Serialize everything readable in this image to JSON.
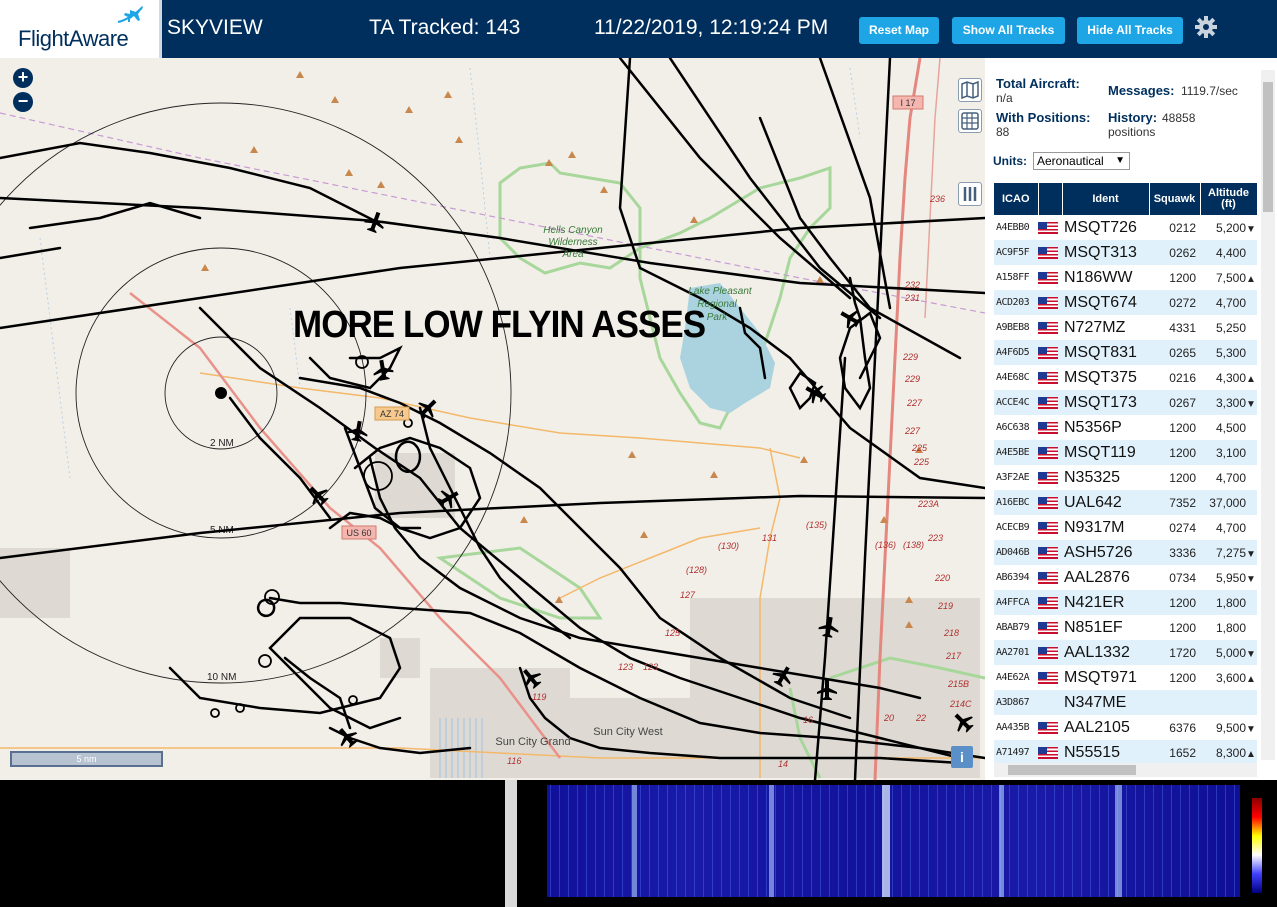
{
  "header": {
    "logo_text": "FlightAware",
    "app_name": "SKYVIEW",
    "tracked_label": "TA Tracked: 143",
    "datetime": "11/22/2019, 12:19:24 PM",
    "reset_map": "Reset Map",
    "show_all_tracks": "Show All Tracks",
    "hide_all_tracks": "Hide All Tracks",
    "settings_icon": "gear-icon",
    "brand_color": "#002f5d",
    "button_color": "#1ea5e6"
  },
  "map": {
    "annotation": "MORE LOW FLYIN ASSES",
    "zoom_in": "+",
    "zoom_out": "−",
    "scale_bar": "5 nm",
    "range_rings": [
      "2 NM",
      "5 NM",
      "10 NM"
    ],
    "place_labels": {
      "hells_canyon_1": "Hells Canyon",
      "hells_canyon_2": "Wilderness",
      "hells_canyon_3": "Area",
      "lake_1": "Lake Pleasant",
      "lake_2": "Regional",
      "lake_3": "Park",
      "sun_city_grand": "Sun City Grand",
      "sun_city_west": "Sun City West",
      "az74": "AZ 74",
      "us60": "US 60",
      "i17": "I 17"
    },
    "route_numbers": [
      "236",
      "232",
      "231",
      "229",
      "229",
      "227",
      "227",
      "225",
      "225",
      "223A",
      "223",
      "220",
      "219",
      "218",
      "217",
      "215B",
      "214C",
      "131",
      "(130)",
      "(128)",
      "127",
      "125",
      "123",
      "123",
      "(135)",
      "(136)",
      "(138)",
      "119",
      "116",
      "16",
      "20",
      "22",
      "14"
    ],
    "info_button": "i"
  },
  "sidebar": {
    "total_aircraft_label": "Total Aircraft:",
    "total_aircraft_value": "n/a",
    "with_positions_label": "With Positions:",
    "with_positions_value": "88",
    "messages_label": "Messages:",
    "messages_value": "1119.7/sec",
    "history_label": "History:",
    "history_value": "48858",
    "history_unit": "positions",
    "units_label": "Units:",
    "units_value": "Aeronautical",
    "columns": [
      "ICAO",
      "",
      "Ident",
      "Squawk",
      "Altitude (ft)"
    ],
    "rows": [
      {
        "icao": "A4EBB0",
        "ident": "MSQT726",
        "squawk": "0212",
        "altitude": "5,200",
        "trend": "▼"
      },
      {
        "icao": "AC9F5F",
        "ident": "MSQT313",
        "squawk": "0262",
        "altitude": "4,400",
        "trend": ""
      },
      {
        "icao": "A158FF",
        "ident": "N186WW",
        "squawk": "1200",
        "altitude": "7,500",
        "trend": "▲"
      },
      {
        "icao": "ACD203",
        "ident": "MSQT674",
        "squawk": "0272",
        "altitude": "4,700",
        "trend": ""
      },
      {
        "icao": "A9BEB8",
        "ident": "N727MZ",
        "squawk": "4331",
        "altitude": "5,250",
        "trend": ""
      },
      {
        "icao": "A4F6D5",
        "ident": "MSQT831",
        "squawk": "0265",
        "altitude": "5,300",
        "trend": ""
      },
      {
        "icao": "A4E68C",
        "ident": "MSQT375",
        "squawk": "0216",
        "altitude": "4,300",
        "trend": "▲"
      },
      {
        "icao": "ACCE4C",
        "ident": "MSQT173",
        "squawk": "0267",
        "altitude": "3,300",
        "trend": "▼"
      },
      {
        "icao": "A6C638",
        "ident": "N5356P",
        "squawk": "1200",
        "altitude": "4,500",
        "trend": ""
      },
      {
        "icao": "A4E5BE",
        "ident": "MSQT119",
        "squawk": "1200",
        "altitude": "3,100",
        "trend": ""
      },
      {
        "icao": "A3F2AE",
        "ident": "N35325",
        "squawk": "1200",
        "altitude": "4,700",
        "trend": ""
      },
      {
        "icao": "A16EBC",
        "ident": "UAL642",
        "squawk": "7352",
        "altitude": "37,000",
        "trend": ""
      },
      {
        "icao": "ACECB9",
        "ident": "N9317M",
        "squawk": "0274",
        "altitude": "4,700",
        "trend": ""
      },
      {
        "icao": "AD046B",
        "ident": "ASH5726",
        "squawk": "3336",
        "altitude": "7,275",
        "trend": "▼"
      },
      {
        "icao": "AB6394",
        "ident": "AAL2876",
        "squawk": "0734",
        "altitude": "5,950",
        "trend": "▼"
      },
      {
        "icao": "A4FFCA",
        "ident": "N421ER",
        "squawk": "1200",
        "altitude": "1,800",
        "trend": ""
      },
      {
        "icao": "ABAB79",
        "ident": "N851EF",
        "squawk": "1200",
        "altitude": "1,800",
        "trend": ""
      },
      {
        "icao": "AA2701",
        "ident": "AAL1332",
        "squawk": "1720",
        "altitude": "5,000",
        "trend": "▼"
      },
      {
        "icao": "A4E62A",
        "ident": "MSQT971",
        "squawk": "1200",
        "altitude": "3,600",
        "trend": "▲"
      },
      {
        "icao": "A3D867",
        "ident": "N347ME",
        "squawk": "",
        "altitude": "",
        "trend": ""
      },
      {
        "icao": "AA435B",
        "ident": "AAL2105",
        "squawk": "6376",
        "altitude": "9,500",
        "trend": "▼"
      },
      {
        "icao": "A71497",
        "ident": "N55515",
        "squawk": "1652",
        "altitude": "8,300",
        "trend": "▲"
      }
    ]
  }
}
